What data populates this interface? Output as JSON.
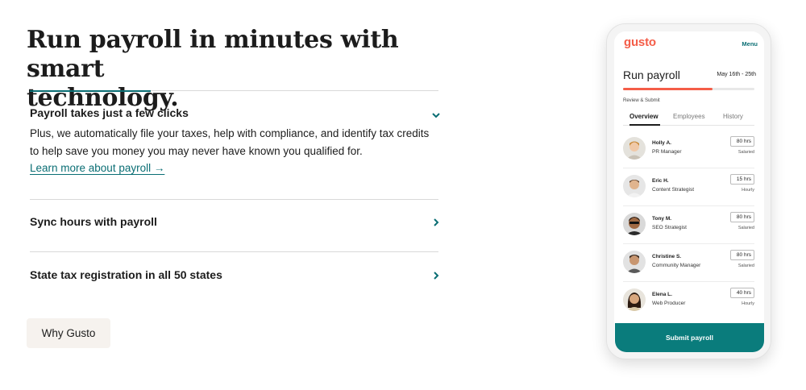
{
  "headline": {
    "line1": "Run payroll in minutes with smart",
    "line2": "technology."
  },
  "accordion": {
    "items": [
      {
        "title": "Payroll takes just a few clicks",
        "expanded": true,
        "body": "Plus, we automatically file your taxes, help with compliance, and identify tax credits to help save you money you may never have known you qualified for.",
        "link": "Learn more about payroll →"
      },
      {
        "title": "Sync hours with payroll",
        "expanded": false
      },
      {
        "title": "State tax registration in all 50 states",
        "expanded": false
      }
    ]
  },
  "cta": {
    "why_label": "Why Gusto"
  },
  "phone": {
    "logo": "gusto",
    "menu": "Menu",
    "title": "Run payroll",
    "date_range": "May 16th - 25th",
    "progress": 0.68,
    "step": "Review & Submit",
    "tabs": [
      "Overview",
      "Employees",
      "History"
    ],
    "active_tab": "Overview",
    "employees": [
      {
        "name": "Holly A.",
        "role": "PR Manager",
        "hours": "80 hrs",
        "type": "Salaried"
      },
      {
        "name": "Eric H.",
        "role": "Content Strategist",
        "hours": "15 hrs",
        "type": "Hourly"
      },
      {
        "name": "Tony M.",
        "role": "SEO Strategist",
        "hours": "80 hrs",
        "type": "Salaried"
      },
      {
        "name": "Christine S.",
        "role": "Community Manager",
        "hours": "80 hrs",
        "type": "Salaried"
      },
      {
        "name": "Elena L.",
        "role": "Web Producer",
        "hours": "40 hrs",
        "type": "Hourly"
      }
    ],
    "submit_label": "Submit payroll"
  },
  "colors": {
    "accent_teal": "#0a6e74",
    "brand_coral": "#f45d48",
    "submit_teal": "#0a7c7c",
    "button_beige": "#f6f2ee"
  }
}
